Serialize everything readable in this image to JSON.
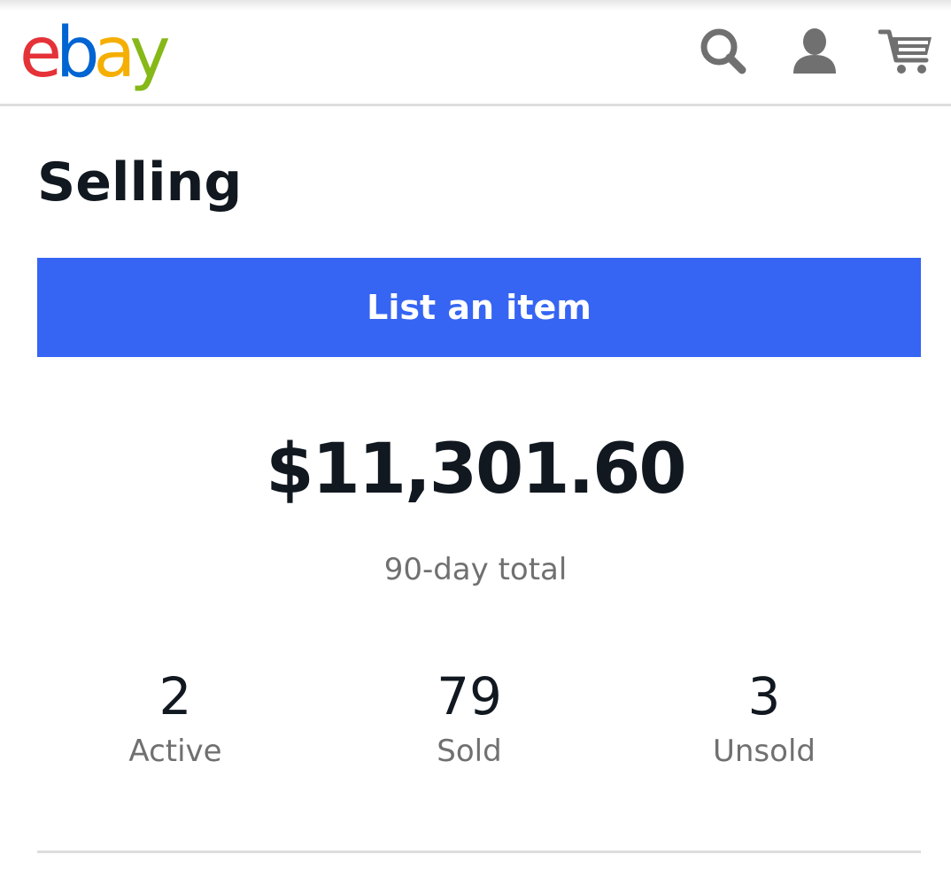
{
  "header": {
    "logo": {
      "letters": [
        {
          "char": "e",
          "color": "#e53238"
        },
        {
          "char": "b",
          "color": "#0064d2"
        },
        {
          "char": "a",
          "color": "#f5af02"
        },
        {
          "char": "y",
          "color": "#86b817"
        }
      ]
    },
    "icons": {
      "search": "search-icon",
      "account": "user-icon",
      "cart": "cart-icon"
    }
  },
  "page": {
    "title": "Selling"
  },
  "actions": {
    "list_item_label": "List an item",
    "accent_color": "#3665f3"
  },
  "summary": {
    "amount": "$11,301.60",
    "period_label": "90-day total"
  },
  "stats": [
    {
      "count": "2",
      "label": "Active"
    },
    {
      "count": "79",
      "label": "Sold"
    },
    {
      "count": "3",
      "label": "Unsold"
    }
  ]
}
